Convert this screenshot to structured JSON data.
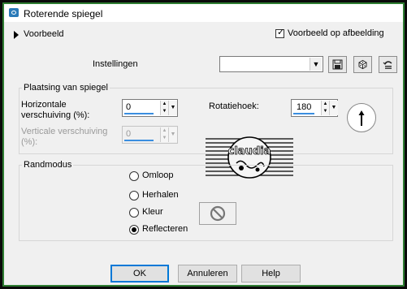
{
  "window": {
    "title": "Roterende spiegel"
  },
  "preview": {
    "label": "Voorbeeld",
    "checkbox_label": "Voorbeeld op afbeelding",
    "checked": true
  },
  "settings": {
    "label": "Instellingen",
    "combo_value": "",
    "tool_icons": [
      "save-icon",
      "dice-icon",
      "reset-icon"
    ]
  },
  "mirror_group": {
    "title": "Plaatsing van spiegel",
    "horizontal_label_line1": "Horizontale",
    "horizontal_label_line2": "verschuiving (%):",
    "horizontal_value": "0",
    "vertical_label_line1": "Verticale verschuiving",
    "vertical_label_line2": "(%):",
    "vertical_value": "0",
    "rotation_label": "Rotatiehoek:",
    "rotation_value": "180"
  },
  "edge_group": {
    "title": "Randmodus",
    "options": [
      "Omloop",
      "Herhalen",
      "Kleur",
      "Reflecteren"
    ],
    "selected": "Reflecteren"
  },
  "logo_text": "claudia",
  "buttons": {
    "ok": "OK",
    "cancel": "Annuleren",
    "help": "Help"
  },
  "colors": {
    "frame": "#2e7d32",
    "accent": "#3a8ee0",
    "default_button": "#0078d7"
  }
}
